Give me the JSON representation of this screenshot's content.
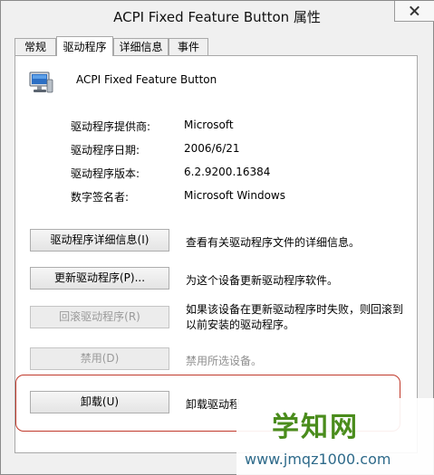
{
  "window": {
    "title": "ACPI Fixed Feature Button 属性"
  },
  "tabs": [
    "常规",
    "驱动程序",
    "详细信息",
    "事件"
  ],
  "device": {
    "icon": "computer-monitor-icon",
    "name": "ACPI Fixed Feature Button"
  },
  "info": [
    {
      "label": "驱动程序提供商:",
      "value": "Microsoft"
    },
    {
      "label": "驱动程序日期:",
      "value": "2006/6/21"
    },
    {
      "label": "驱动程序版本:",
      "value": "6.2.9200.16384"
    },
    {
      "label": "数字签名者:",
      "value": "Microsoft Windows"
    }
  ],
  "actions": [
    {
      "label": "驱动程序详细信息(I)",
      "description": "查看有关驱动程序文件的详细信息。",
      "enabled": true
    },
    {
      "label": "更新驱动程序(P)...",
      "description": "为这个设备更新驱动程序软件。",
      "enabled": true
    },
    {
      "label": "回滚驱动程序(R)",
      "description": "如果该设备在更新驱动程序时失败，则回滚到以前安装的驱动程序。",
      "enabled": false
    },
    {
      "label": "禁用(D)",
      "description": "禁用所选设备。",
      "enabled": false
    },
    {
      "label": "卸载(U)",
      "description": "卸载驱动程",
      "enabled": true
    }
  ],
  "watermark": {
    "title": "学知网",
    "url": "www.jmqz1000.com"
  },
  "colors": {
    "highlight": "#c0392b",
    "watermark_title": "#4a8c1c"
  }
}
